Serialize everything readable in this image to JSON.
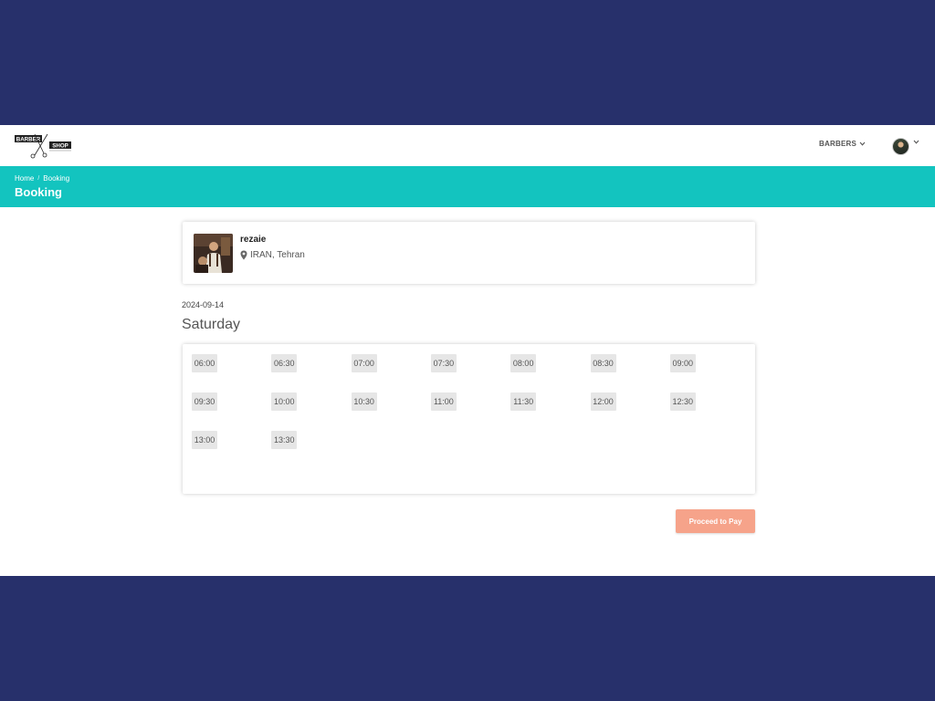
{
  "brand": {
    "word1": "BARBER",
    "word2": "SHOP"
  },
  "nav": {
    "barbers_label": "BARBERS"
  },
  "breadcrumb": {
    "home": "Home",
    "current": "Booking"
  },
  "page_title": "Booking",
  "barber": {
    "name": "rezaie",
    "location": "IRAN, Tehran"
  },
  "booking": {
    "date": "2024-09-14",
    "day": "Saturday",
    "slots": [
      "06:00",
      "06:30",
      "07:00",
      "07:30",
      "08:00",
      "08:30",
      "09:00",
      "09:30",
      "10:00",
      "10:30",
      "11:00",
      "11:30",
      "12:00",
      "12:30",
      "13:00",
      "13:30"
    ]
  },
  "actions": {
    "proceed_label": "Proceed to Pay"
  },
  "colors": {
    "backdrop": "#27306b",
    "header_band": "#13c4bf",
    "slot_bg": "#e6e6e6",
    "pay_button": "#f6a38a"
  }
}
